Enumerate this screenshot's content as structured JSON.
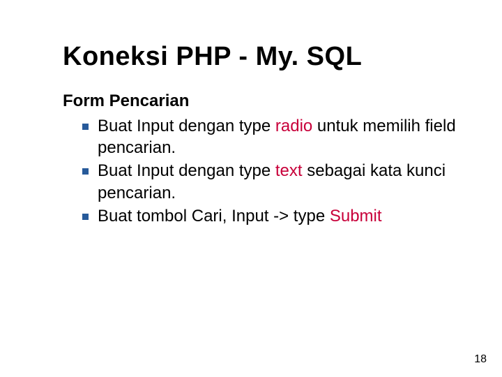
{
  "title": "Koneksi PHP - My. SQL",
  "subtitle": "Form Pencarian",
  "bullets": [
    {
      "pre": "Buat Input dengan type ",
      "hl": "radio",
      "post": " untuk memilih field pencarian."
    },
    {
      "pre": "Buat Input dengan type ",
      "hl": "text",
      "post": " sebagai kata kunci pencarian."
    },
    {
      "pre": "Buat tombol Cari, Input -> type ",
      "hl": "Submit",
      "post": ""
    }
  ],
  "page_number": "18",
  "colors": {
    "bullet": "#275a9a",
    "highlight": "#c8003a"
  }
}
